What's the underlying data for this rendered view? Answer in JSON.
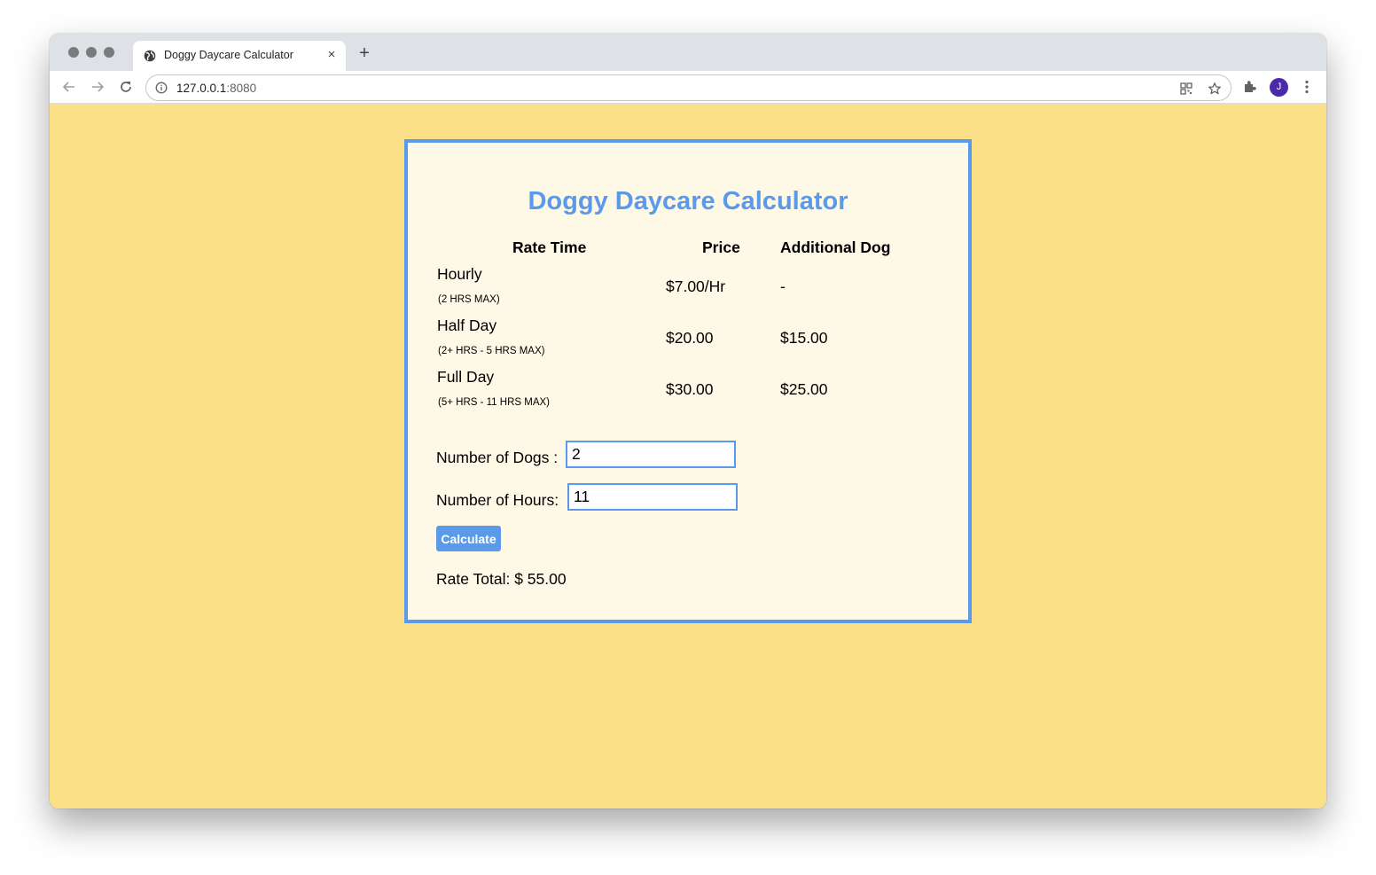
{
  "browser": {
    "tab_title": "Doggy Daycare Calculator",
    "tab_close": "×",
    "new_tab": "+",
    "url_host": "127.0.0.1",
    "url_port": ":8080",
    "profile_initial": "J",
    "icons": [
      "globe-icon",
      "back-icon",
      "forward-icon",
      "reload-icon",
      "info-icon",
      "qr-code-icon",
      "star-icon",
      "extensions-icon",
      "menu-icon"
    ]
  },
  "page": {
    "title": "Doggy Daycare Calculator",
    "headers": {
      "rate_time": "Rate Time",
      "price": "Price",
      "additional": "Additional Dog"
    },
    "rates": [
      {
        "name": "Hourly",
        "note": "(2 HRS MAX)",
        "price": "$7.00/Hr",
        "additional": "-"
      },
      {
        "name": "Half Day",
        "note": "(2+ HRS - 5 HRS MAX)",
        "price": "$20.00",
        "additional": "$15.00"
      },
      {
        "name": "Full Day",
        "note": "(5+ HRS - 11 HRS MAX)",
        "price": "$30.00",
        "additional": "$25.00"
      }
    ],
    "dogs_label": "Number of Dogs :",
    "dogs_value": "2",
    "hours_label": "Number of Hours:",
    "hours_value": "11",
    "calculate_label": "Calculate",
    "total_text": "Rate Total: $ 55.00"
  },
  "colors": {
    "accent": "#5b99ea",
    "background": "#fbe088",
    "card": "#fef8e6"
  }
}
